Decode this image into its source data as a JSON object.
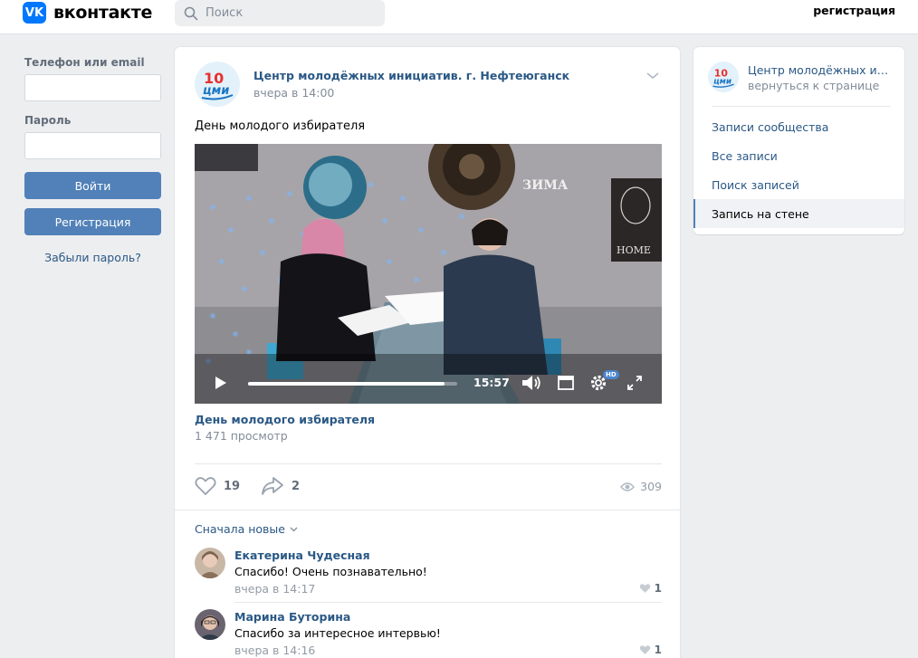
{
  "header": {
    "logo_mark": "VK",
    "logo_text": "вконтакте",
    "search_placeholder": "Поиск",
    "register_link": "регистрация"
  },
  "login": {
    "phone_label": "Телефон или email",
    "password_label": "Пароль",
    "login_button": "Войти",
    "register_button": "Регистрация",
    "forgot_link": "Забыли пароль?"
  },
  "post": {
    "author": "Центр молодёжных инициатив. г. Нефтеюганск",
    "time": "вчера в 14:00",
    "text": "День молодого избирателя",
    "video": {
      "sign_text": "ЗИМА",
      "sign_home": "HOME",
      "duration": "15:57",
      "hd_badge": "HD",
      "progress": 0.94
    },
    "video_title": "День молодого избирателя",
    "video_views": "1 471 просмотр",
    "likes": "19",
    "shares": "2",
    "views": "309",
    "sort_label": "Сначала новые"
  },
  "comments": [
    {
      "name": "Екатерина Чудесная",
      "text": "Спасибо! Очень познавательно!",
      "time": "вчера в 14:17",
      "likes": "1"
    },
    {
      "name": "Марина Буторина",
      "text": "Спасибо за интересное интервью!",
      "time": "вчера в 14:16",
      "likes": "1"
    }
  ],
  "sidebar": {
    "community_name": "Центр молодёжных инициатив. г. Нефтеюганск",
    "back_link": "вернуться к странице",
    "items": [
      {
        "label": "Записи сообщества"
      },
      {
        "label": "Все записи"
      },
      {
        "label": "Поиск записей"
      },
      {
        "label": "Запись на стене"
      }
    ]
  },
  "logo_badge": {
    "number": "10",
    "text": "цми"
  },
  "colors": {
    "brand": "#0077ff",
    "link": "#2a5885",
    "button": "#5181b8",
    "background": "#edeef0"
  }
}
